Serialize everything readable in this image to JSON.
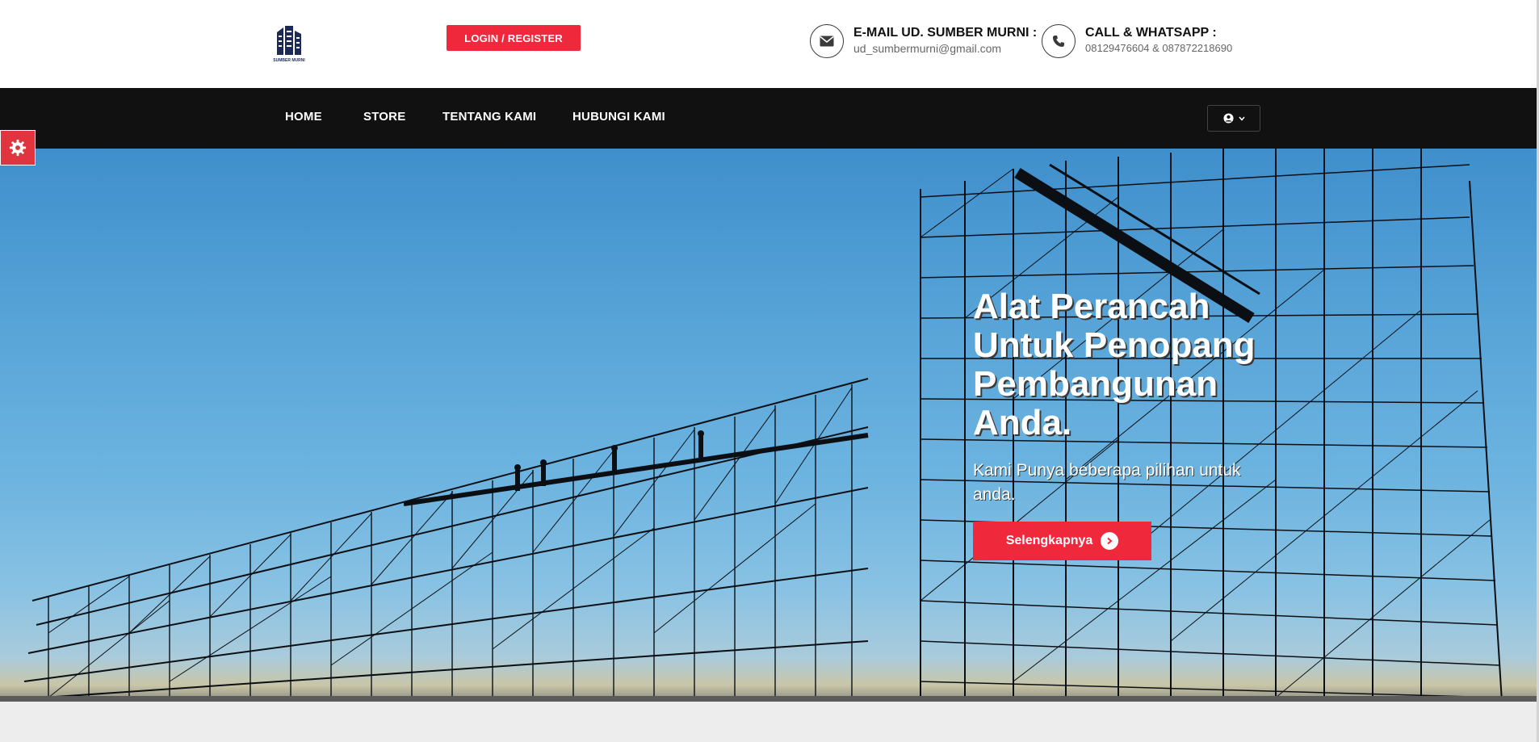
{
  "header": {
    "logo_text": "SUMBER MURNI",
    "login_label": "LOGIN / REGISTER",
    "email": {
      "title": "E-MAIL UD. SUMBER MURNI :",
      "value": "ud_sumbermurni@gmail.com"
    },
    "phone": {
      "title": "CALL & WHATSAPP :",
      "value": "08129476604 & 087872218690"
    }
  },
  "nav": {
    "items": [
      {
        "label": "HOME"
      },
      {
        "label": "STORE"
      },
      {
        "label": "TENTANG KAMI"
      },
      {
        "label": "HUBUNGI KAMI"
      }
    ]
  },
  "hero": {
    "title": "Alat Perancah Untuk Penopang Pembangunan Anda.",
    "subtitle": "Kami Punya beberapa pilihan untuk anda.",
    "cta_label": "Selengkapnya"
  },
  "colors": {
    "accent": "#f0283c",
    "nav_bg": "#111111"
  },
  "icons": [
    "building-logo-icon",
    "envelope-icon",
    "phone-icon",
    "user-circle-icon",
    "chevron-down-icon",
    "gear-icon",
    "chevron-right-icon"
  ]
}
